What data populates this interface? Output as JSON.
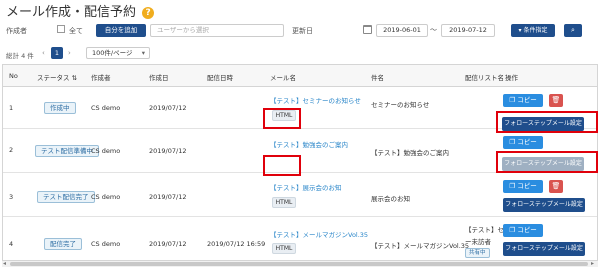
{
  "page": {
    "title": "メール作成・配信予約",
    "help_icon": "?"
  },
  "filter": {
    "creator_label": "作成者",
    "all_label": "全て",
    "self_button": "自分を追加",
    "user_placeholder": "ユーザーから選択",
    "updated_label": "更新日",
    "date_from": "2019-06-01",
    "date_sep": "～",
    "date_to": "2019-07-12",
    "condition_button": "▾ 条件指定",
    "search_icon": "search-icon"
  },
  "pager": {
    "total": "総計 4 件",
    "prev": "‹",
    "page": "1",
    "next": "›",
    "per_page": "100件/ページ"
  },
  "table": {
    "headers": [
      "No",
      "ステータス",
      "作成者",
      "作成日",
      "配信日時",
      "メール名",
      "件名",
      "配信リスト名",
      "操作"
    ],
    "sort_icon": "⇅",
    "rows": [
      {
        "no": "1",
        "status": "作成中",
        "creator": "CS demo",
        "created": "2019/07/12",
        "sent": "",
        "mail_name": "【テスト】セミナーのお知らせ",
        "format": "HTML",
        "subject": "セミナーのお知らせ",
        "list": "",
        "copy": "コピー",
        "follow": "フォローステップメール設定",
        "has_delete": true,
        "follow_disabled": false
      },
      {
        "no": "2",
        "status": "テスト配信準備中",
        "creator": "CS demo",
        "created": "2019/07/12",
        "sent": "",
        "mail_name": "【テスト】勉強会のご案内",
        "format": "",
        "subject": "【テスト】勉強会のご案内",
        "list": "",
        "copy": "コピー",
        "follow": "フォローステップメール設定",
        "has_delete": false,
        "follow_disabled": true
      },
      {
        "no": "3",
        "status": "テスト配信完了",
        "creator": "CS demo",
        "created": "2019/07/12",
        "sent": "",
        "mail_name": "【テスト】展示会のお知",
        "format": "HTML",
        "subject": "展示会のお知",
        "list": "",
        "copy": "コピー",
        "follow": "フォローステップメール設定",
        "has_delete": true,
        "follow_disabled": false
      },
      {
        "no": "4",
        "status": "配信完了",
        "creator": "CS demo",
        "created": "2019/07/12",
        "sent": "2019/07/12 16:59",
        "mail_name": "【テスト】メールマガジンVol.35",
        "format": "HTML",
        "subject": "【テスト】メールマガジンVol.35",
        "list": "【テスト】セ",
        "list2": "ー未訪者",
        "list_badge": "共有中",
        "copy": "コピー",
        "follow": "フォローステップメール設定",
        "has_delete": false,
        "follow_disabled": false
      }
    ]
  }
}
